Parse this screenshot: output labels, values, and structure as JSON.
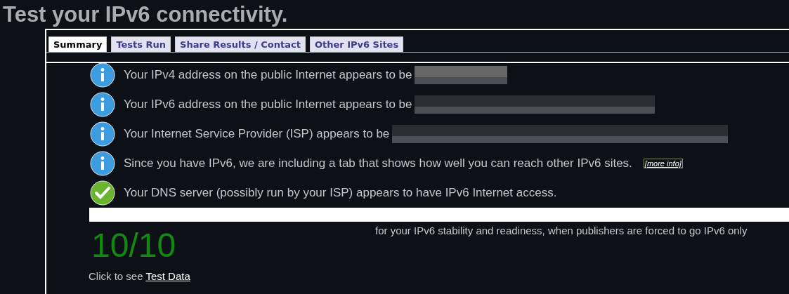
{
  "title": "Test your IPv6 connectivity.",
  "tabs": [
    {
      "label": "Summary",
      "selected": true
    },
    {
      "label": "Tests Run",
      "selected": false
    },
    {
      "label": "Share Results / Contact",
      "selected": false
    },
    {
      "label": "Other IPv6 Sites",
      "selected": false
    }
  ],
  "results": [
    {
      "kind": "info",
      "text": "Your IPv4 address on the public Internet appears to be",
      "redacted": true
    },
    {
      "kind": "info",
      "text": "Your IPv6 address on the public Internet appears to be",
      "redacted": true
    },
    {
      "kind": "info",
      "text": "Your Internet Service Provider (ISP) appears to be",
      "redacted": true
    },
    {
      "kind": "info",
      "text": "Since you have IPv6, we are including a tab that shows how well you can reach other IPv6 sites.",
      "link": "[more info]",
      "redacted": false
    },
    {
      "kind": "ok",
      "text": "Your DNS server (possibly run by your ISP) appears to have IPv6 Internet access.",
      "redacted": false
    }
  ],
  "score": "10/10",
  "score_note": "for your IPv6 stability and readiness, when publishers are forced to go IPv6 only",
  "footer": {
    "text": "Click to see",
    "link": "Test Data"
  }
}
